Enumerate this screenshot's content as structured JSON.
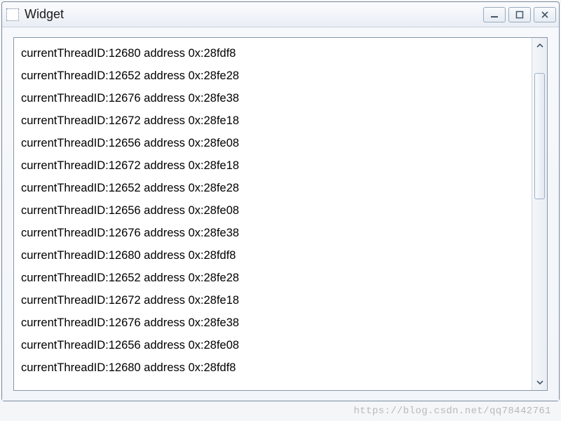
{
  "window": {
    "title": "Widget"
  },
  "log_lines": [
    "currentThreadID:12680 address 0x:28fdf8",
    "currentThreadID:12652 address 0x:28fe28",
    "currentThreadID:12676 address 0x:28fe38",
    "currentThreadID:12672 address 0x:28fe18",
    "currentThreadID:12656 address 0x:28fe08",
    "currentThreadID:12672 address 0x:28fe18",
    "currentThreadID:12652 address 0x:28fe28",
    "currentThreadID:12656 address 0x:28fe08",
    "currentThreadID:12676 address 0x:28fe38",
    "currentThreadID:12680 address 0x:28fdf8",
    "currentThreadID:12652 address 0x:28fe28",
    "currentThreadID:12672 address 0x:28fe18",
    "currentThreadID:12676 address 0x:28fe38",
    "currentThreadID:12656 address 0x:28fe08",
    "currentThreadID:12680 address 0x:28fdf8"
  ],
  "watermark": "https://blog.csdn.net/qq78442761"
}
